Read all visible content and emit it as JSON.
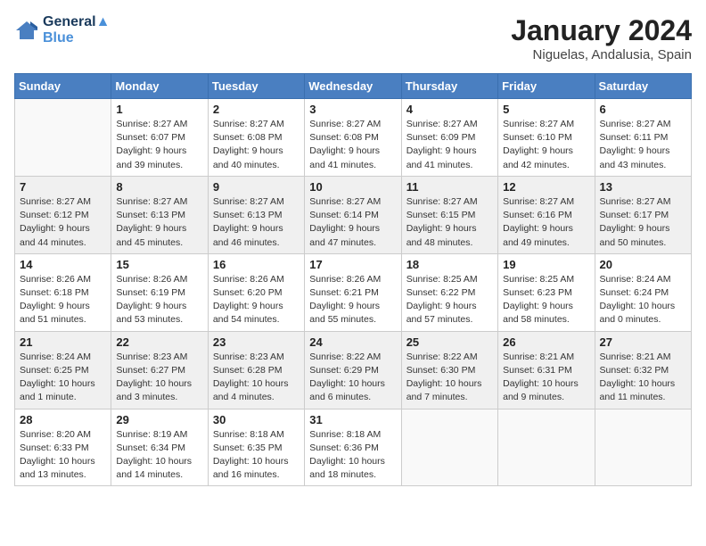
{
  "logo": {
    "line1": "General",
    "line2": "Blue"
  },
  "title": "January 2024",
  "location": "Niguelas, Andalusia, Spain",
  "weekdays": [
    "Sunday",
    "Monday",
    "Tuesday",
    "Wednesday",
    "Thursday",
    "Friday",
    "Saturday"
  ],
  "weeks": [
    [
      {
        "day": "",
        "info": ""
      },
      {
        "day": "1",
        "info": "Sunrise: 8:27 AM\nSunset: 6:07 PM\nDaylight: 9 hours\nand 39 minutes."
      },
      {
        "day": "2",
        "info": "Sunrise: 8:27 AM\nSunset: 6:08 PM\nDaylight: 9 hours\nand 40 minutes."
      },
      {
        "day": "3",
        "info": "Sunrise: 8:27 AM\nSunset: 6:08 PM\nDaylight: 9 hours\nand 41 minutes."
      },
      {
        "day": "4",
        "info": "Sunrise: 8:27 AM\nSunset: 6:09 PM\nDaylight: 9 hours\nand 41 minutes."
      },
      {
        "day": "5",
        "info": "Sunrise: 8:27 AM\nSunset: 6:10 PM\nDaylight: 9 hours\nand 42 minutes."
      },
      {
        "day": "6",
        "info": "Sunrise: 8:27 AM\nSunset: 6:11 PM\nDaylight: 9 hours\nand 43 minutes."
      }
    ],
    [
      {
        "day": "7",
        "info": "Sunrise: 8:27 AM\nSunset: 6:12 PM\nDaylight: 9 hours\nand 44 minutes."
      },
      {
        "day": "8",
        "info": "Sunrise: 8:27 AM\nSunset: 6:13 PM\nDaylight: 9 hours\nand 45 minutes."
      },
      {
        "day": "9",
        "info": "Sunrise: 8:27 AM\nSunset: 6:13 PM\nDaylight: 9 hours\nand 46 minutes."
      },
      {
        "day": "10",
        "info": "Sunrise: 8:27 AM\nSunset: 6:14 PM\nDaylight: 9 hours\nand 47 minutes."
      },
      {
        "day": "11",
        "info": "Sunrise: 8:27 AM\nSunset: 6:15 PM\nDaylight: 9 hours\nand 48 minutes."
      },
      {
        "day": "12",
        "info": "Sunrise: 8:27 AM\nSunset: 6:16 PM\nDaylight: 9 hours\nand 49 minutes."
      },
      {
        "day": "13",
        "info": "Sunrise: 8:27 AM\nSunset: 6:17 PM\nDaylight: 9 hours\nand 50 minutes."
      }
    ],
    [
      {
        "day": "14",
        "info": "Sunrise: 8:26 AM\nSunset: 6:18 PM\nDaylight: 9 hours\nand 51 minutes."
      },
      {
        "day": "15",
        "info": "Sunrise: 8:26 AM\nSunset: 6:19 PM\nDaylight: 9 hours\nand 53 minutes."
      },
      {
        "day": "16",
        "info": "Sunrise: 8:26 AM\nSunset: 6:20 PM\nDaylight: 9 hours\nand 54 minutes."
      },
      {
        "day": "17",
        "info": "Sunrise: 8:26 AM\nSunset: 6:21 PM\nDaylight: 9 hours\nand 55 minutes."
      },
      {
        "day": "18",
        "info": "Sunrise: 8:25 AM\nSunset: 6:22 PM\nDaylight: 9 hours\nand 57 minutes."
      },
      {
        "day": "19",
        "info": "Sunrise: 8:25 AM\nSunset: 6:23 PM\nDaylight: 9 hours\nand 58 minutes."
      },
      {
        "day": "20",
        "info": "Sunrise: 8:24 AM\nSunset: 6:24 PM\nDaylight: 10 hours\nand 0 minutes."
      }
    ],
    [
      {
        "day": "21",
        "info": "Sunrise: 8:24 AM\nSunset: 6:25 PM\nDaylight: 10 hours\nand 1 minute."
      },
      {
        "day": "22",
        "info": "Sunrise: 8:23 AM\nSunset: 6:27 PM\nDaylight: 10 hours\nand 3 minutes."
      },
      {
        "day": "23",
        "info": "Sunrise: 8:23 AM\nSunset: 6:28 PM\nDaylight: 10 hours\nand 4 minutes."
      },
      {
        "day": "24",
        "info": "Sunrise: 8:22 AM\nSunset: 6:29 PM\nDaylight: 10 hours\nand 6 minutes."
      },
      {
        "day": "25",
        "info": "Sunrise: 8:22 AM\nSunset: 6:30 PM\nDaylight: 10 hours\nand 7 minutes."
      },
      {
        "day": "26",
        "info": "Sunrise: 8:21 AM\nSunset: 6:31 PM\nDaylight: 10 hours\nand 9 minutes."
      },
      {
        "day": "27",
        "info": "Sunrise: 8:21 AM\nSunset: 6:32 PM\nDaylight: 10 hours\nand 11 minutes."
      }
    ],
    [
      {
        "day": "28",
        "info": "Sunrise: 8:20 AM\nSunset: 6:33 PM\nDaylight: 10 hours\nand 13 minutes."
      },
      {
        "day": "29",
        "info": "Sunrise: 8:19 AM\nSunset: 6:34 PM\nDaylight: 10 hours\nand 14 minutes."
      },
      {
        "day": "30",
        "info": "Sunrise: 8:18 AM\nSunset: 6:35 PM\nDaylight: 10 hours\nand 16 minutes."
      },
      {
        "day": "31",
        "info": "Sunrise: 8:18 AM\nSunset: 6:36 PM\nDaylight: 10 hours\nand 18 minutes."
      },
      {
        "day": "",
        "info": ""
      },
      {
        "day": "",
        "info": ""
      },
      {
        "day": "",
        "info": ""
      }
    ]
  ]
}
